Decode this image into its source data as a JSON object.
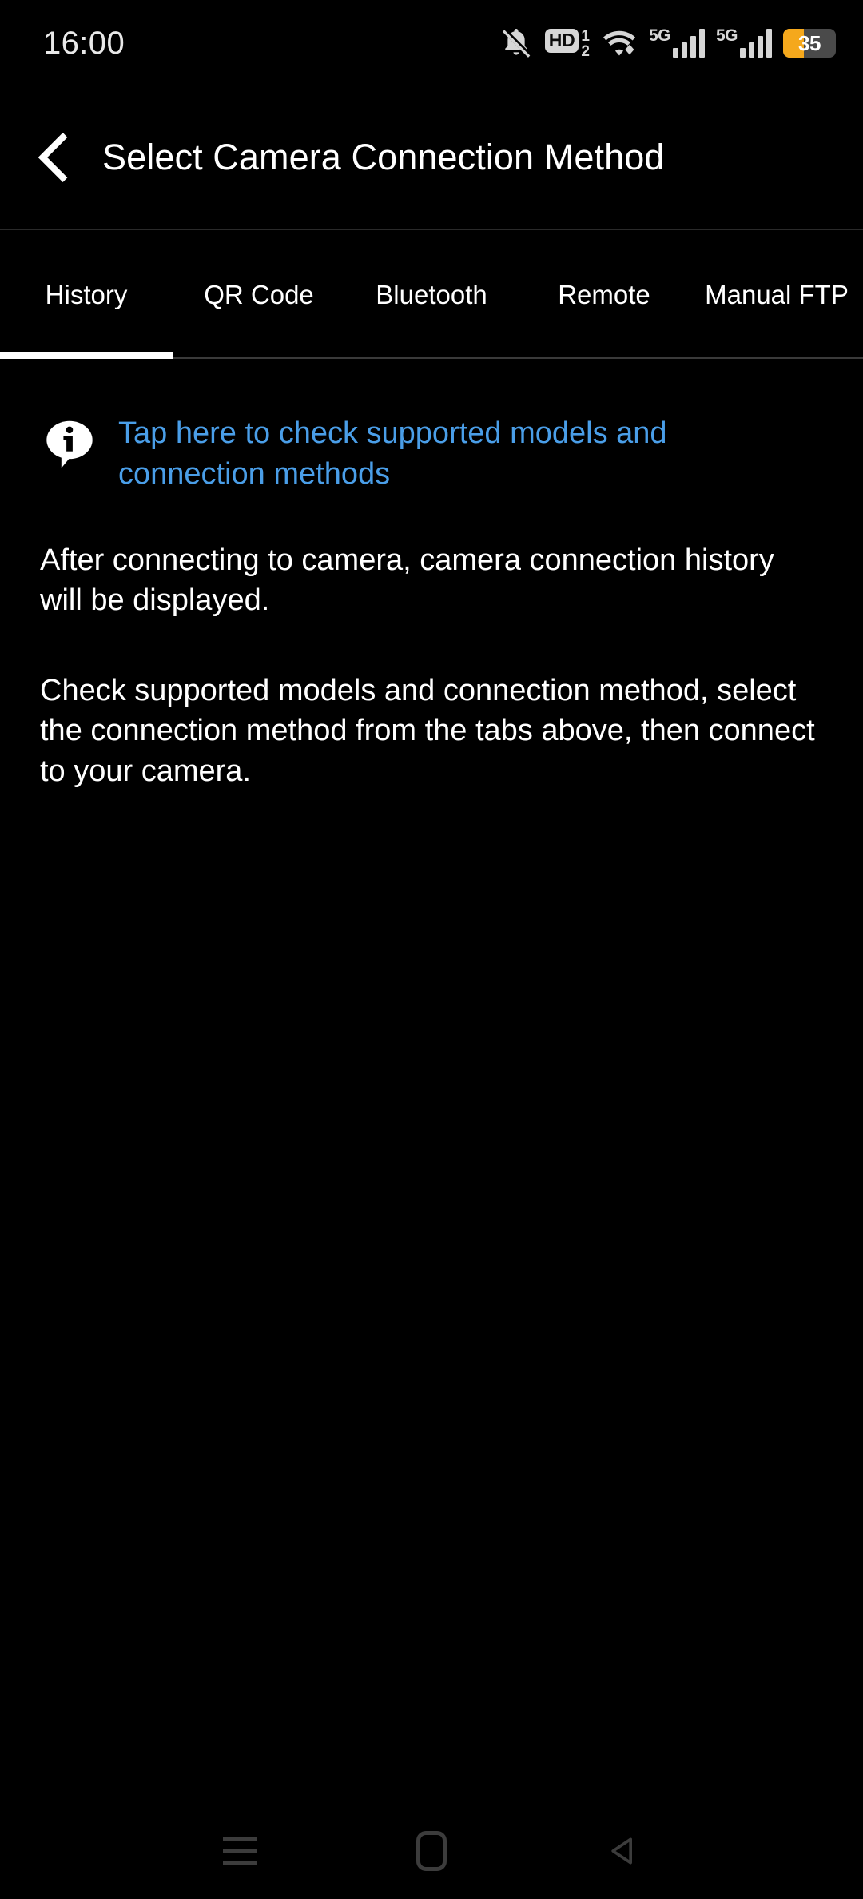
{
  "status_bar": {
    "time": "16:00",
    "icons": [
      {
        "name": "notifications-muted-icon",
        "label": "silent"
      },
      {
        "name": "hd-voice-icon",
        "label": "HD",
        "sup": "1",
        "sub": "2"
      },
      {
        "name": "wifi-icon",
        "label": "wifi"
      },
      {
        "name": "signal-5g-sim1-icon",
        "label": "5G"
      },
      {
        "name": "signal-5g-sim2-icon",
        "label": "5G"
      }
    ],
    "battery": {
      "percent": "35",
      "fill_percent": 40,
      "fill_color": "#f5a81c",
      "body_color": "#4a4a4a"
    }
  },
  "app_bar": {
    "back_label": "Back",
    "title": "Select Camera Connection Method"
  },
  "tabs": {
    "active_index": 0,
    "items": [
      {
        "label": "History"
      },
      {
        "label": "QR Code"
      },
      {
        "label": "Bluetooth"
      },
      {
        "label": "Remote"
      },
      {
        "label": "Manual FTP"
      }
    ],
    "active_indicator_color": "#ffffff"
  },
  "content": {
    "info_link": "Tap here to check supported models and connection methods",
    "info_link_color": "#4a9ee8",
    "paragraph_1": "After connecting to camera, camera connection history will be displayed.",
    "paragraph_2": "Check supported models and connection method, select the connection method from the tabs above, then connect to your camera."
  },
  "nav_bar": {
    "recents_label": "Recents",
    "home_label": "Home",
    "back_label": "Back"
  },
  "theme": {
    "background": "#000000",
    "text": "#ffffff",
    "accent": "#4a9ee8",
    "divider": "#2a2a2a"
  }
}
